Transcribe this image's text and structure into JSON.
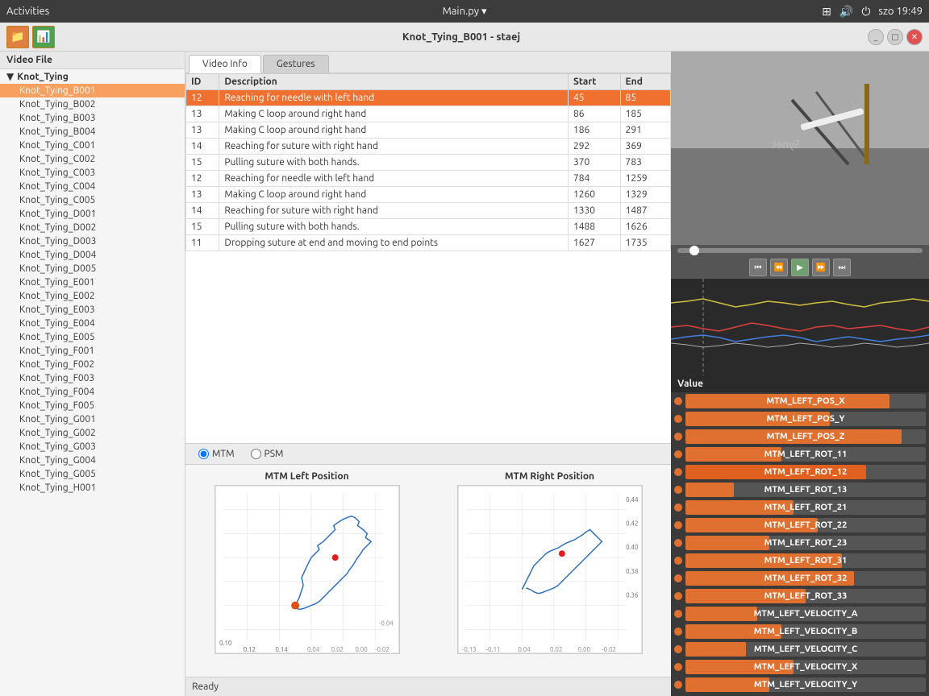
{
  "topbar": {
    "activities": "Activities",
    "app_name": "Main.py",
    "time": "szo 19:49"
  },
  "window": {
    "title": "Knot_Tying_B001 - staej"
  },
  "sidebar": {
    "header": "Video File",
    "tree_root": "Knot_Tying",
    "items": [
      "Knot_Tying_B001",
      "Knot_Tying_B002",
      "Knot_Tying_B003",
      "Knot_Tying_B004",
      "Knot_Tying_C001",
      "Knot_Tying_C002",
      "Knot_Tying_C003",
      "Knot_Tying_C004",
      "Knot_Tying_C005",
      "Knot_Tying_D001",
      "Knot_Tying_D002",
      "Knot_Tying_D003",
      "Knot_Tying_D004",
      "Knot_Tying_D005",
      "Knot_Tying_E001",
      "Knot_Tying_E002",
      "Knot_Tying_E003",
      "Knot_Tying_E004",
      "Knot_Tying_E005",
      "Knot_Tying_F001",
      "Knot_Tying_F002",
      "Knot_Tying_F003",
      "Knot_Tying_F004",
      "Knot_Tying_F005",
      "Knot_Tying_G001",
      "Knot_Tying_G002",
      "Knot_Tying_G003",
      "Knot_Tying_G004",
      "Knot_Tying_G005",
      "Knot_Tying_H001"
    ]
  },
  "tabs": {
    "video_info": "Video Info",
    "gestures": "Gestures"
  },
  "table": {
    "headers": [
      "ID",
      "Description",
      "Start",
      "End"
    ],
    "rows": [
      {
        "id": "12",
        "desc": "Reaching for needle with left hand",
        "start": "45",
        "end": "85",
        "selected": true
      },
      {
        "id": "13",
        "desc": "Making C loop around right hand",
        "start": "86",
        "end": "185",
        "selected": false
      },
      {
        "id": "13",
        "desc": "Making C loop around right hand",
        "start": "186",
        "end": "291",
        "selected": false
      },
      {
        "id": "14",
        "desc": "Reaching for suture with right hand",
        "start": "292",
        "end": "369",
        "selected": false
      },
      {
        "id": "15",
        "desc": "Pulling suture with both hands.",
        "start": "370",
        "end": "783",
        "selected": false
      },
      {
        "id": "12",
        "desc": "Reaching for needle with left hand",
        "start": "784",
        "end": "1259",
        "selected": false
      },
      {
        "id": "13",
        "desc": "Making C loop around right hand",
        "start": "1260",
        "end": "1329",
        "selected": false
      },
      {
        "id": "14",
        "desc": "Reaching for suture with right hand",
        "start": "1330",
        "end": "1487",
        "selected": false
      },
      {
        "id": "15",
        "desc": "Pulling suture with both hands.",
        "start": "1488",
        "end": "1626",
        "selected": false
      },
      {
        "id": "11",
        "desc": "Dropping suture at end and moving to end points",
        "start": "1627",
        "end": "1735",
        "selected": false
      }
    ]
  },
  "radio": {
    "mtm_label": "MTM",
    "psm_label": "PSM",
    "selected": "MTM"
  },
  "charts": {
    "left_title": "MTM Left Position",
    "right_title": "MTM Right Position"
  },
  "values_panel": {
    "header": "Value",
    "items": [
      {
        "label": "MTM_LEFT_POS_X",
        "fill": 85
      },
      {
        "label": "MTM_LEFT_POS_Y",
        "fill": 60
      },
      {
        "label": "MTM_LEFT_POS_Z",
        "fill": 90
      },
      {
        "label": "MTM_LEFT_ROT_11",
        "fill": 40
      },
      {
        "label": "MTM_LEFT_ROT_12",
        "fill": 75
      },
      {
        "label": "MTM_LEFT_ROT_13",
        "fill": 20
      },
      {
        "label": "MTM_LEFT_ROT_21",
        "fill": 45
      },
      {
        "label": "MTM_LEFT_ROT_22",
        "fill": 55
      },
      {
        "label": "MTM_LEFT_ROT_23",
        "fill": 35
      },
      {
        "label": "MTM_LEFT_ROT_31",
        "fill": 65
      },
      {
        "label": "MTM_LEFT_ROT_32",
        "fill": 70
      },
      {
        "label": "MTM_LEFT_ROT_33",
        "fill": 50
      },
      {
        "label": "MTM_LEFT_VELOCITY_A",
        "fill": 30
      },
      {
        "label": "MTM_LEFT_VELOCITY_B",
        "fill": 40
      },
      {
        "label": "MTM_LEFT_VELOCITY_C",
        "fill": 25
      },
      {
        "label": "MTM_LEFT_VELOCITY_X",
        "fill": 45
      },
      {
        "label": "MTM_LEFT_VELOCITY_Y",
        "fill": 35
      }
    ]
  },
  "status": "Ready",
  "playback_buttons": [
    "⏮",
    "⏪",
    "▶",
    "⏩",
    "⏭"
  ]
}
